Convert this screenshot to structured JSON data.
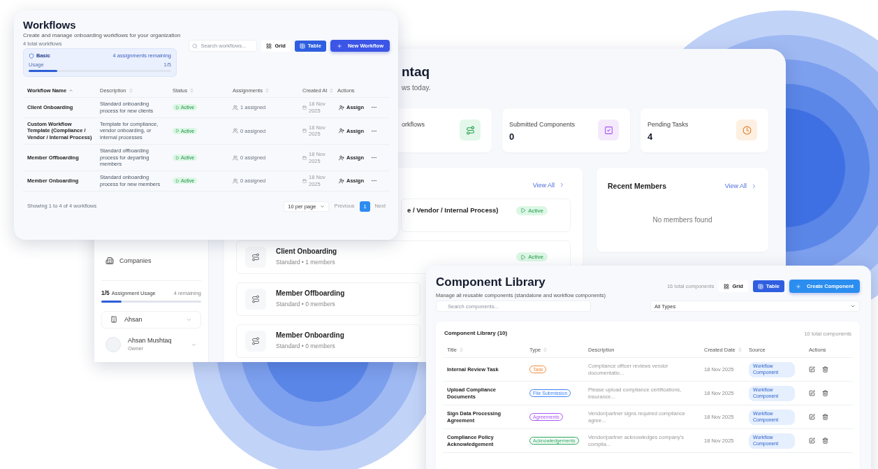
{
  "workflows_window": {
    "title": "Workflows",
    "subtitle": "Create and manage onboarding workflows for your organization",
    "count": "4 total workflows",
    "plan": {
      "name": "Basic",
      "remaining": "4 assignments remaining",
      "usage_label": "Usage",
      "usage": "1/5",
      "level": 0.2
    },
    "search": {
      "placeholder": "Search workflows..."
    },
    "view_toggle": [
      {
        "label": "Grid",
        "selected": false
      },
      {
        "label": "Table",
        "selected": true
      }
    ],
    "new_button": "New Workflow",
    "table": {
      "columns": [
        {
          "label": "Workflow Name",
          "sortable": true,
          "sorted": true
        },
        {
          "label": "Description",
          "sortable": true,
          "sorted": false
        },
        {
          "label": "Status",
          "sortable": true,
          "sorted": false
        },
        {
          "label": "Assignments",
          "sortable": true,
          "sorted": false
        },
        {
          "label": "Created At",
          "sortable": true,
          "sorted": false
        },
        {
          "label": "Actions",
          "sortable": false,
          "sorted": false
        }
      ],
      "rows": [
        {
          "name": "Client Onboarding",
          "description": "Standard onboarding process for new clients",
          "status": "Active",
          "assignments": "1 assigned",
          "created": "18 Nov 2025",
          "action": "Assign"
        },
        {
          "name": "Custom Workflow Template (Compliance / Vendor / Internal Process)",
          "description": "Template for compliance, vendor onboarding, or internal processes",
          "status": "Active",
          "assignments": "0 assigned",
          "created": "18 Nov 2025",
          "action": "Assign"
        },
        {
          "name": "Member Offboarding",
          "description": "Standard offboarding process for departing members",
          "status": "Active",
          "assignments": "0 assigned",
          "created": "18 Nov 2025",
          "action": "Assign"
        },
        {
          "name": "Member Onboarding",
          "description": "Standard onboarding process for new members",
          "status": "Active",
          "assignments": "0 assigned",
          "created": "18 Nov 2025",
          "action": "Assign"
        }
      ]
    },
    "footer": {
      "showing": "Showing 1 to 4 of 4 workflows",
      "per_page": "10 per page",
      "previous": "Previous",
      "pages": [
        {
          "label": "1",
          "selected": true
        }
      ],
      "next": "Next"
    }
  },
  "dashboard": {
    "heading": "ntaq",
    "subheading": "ws today.",
    "stats": [
      {
        "label": "orkflows",
        "kind": "workflow"
      },
      {
        "label": "Submitted Components",
        "value": "0",
        "kind": "components"
      },
      {
        "label": "Pending Tasks",
        "value": "4",
        "kind": "tasks"
      }
    ],
    "recent_workflows": {
      "view_all": "View All",
      "items": [
        {
          "kind": "clipped",
          "name": "e / Vendor / Internal Process)",
          "status": "Active"
        },
        {
          "kind": "full",
          "name": "Client Onboarding",
          "meta": "Standard • 1 members",
          "status": "Active"
        },
        {
          "kind": "cut",
          "name": "Member Offboarding",
          "meta": "Standard • 0 members"
        },
        {
          "kind": "cut",
          "name": "Member Onboarding",
          "meta": "Standard • 0 members"
        }
      ]
    },
    "recent_members": {
      "title": "Recent Members",
      "view_all": "View All",
      "empty": "No members found"
    },
    "sidebar": {
      "nav": [
        {
          "label": "Companies",
          "selected": false
        }
      ],
      "usage": {
        "count": "1/5",
        "label": "Assignment Usage",
        "remaining": "4 remaining",
        "level": 0.2
      },
      "workspace": "Ahsan",
      "user": {
        "name": "Ahsan Mushtaq",
        "role": "Owner"
      }
    }
  },
  "component_library": {
    "title": "Component Library",
    "subtitle": "Manage all reusable components (standalone and workflow components)",
    "total": "16 total components",
    "view_toggle": [
      {
        "label": "Grid",
        "selected": false
      },
      {
        "label": "Table",
        "selected": true
      }
    ],
    "create_button": "Create Component",
    "search": {
      "placeholder": "Search components..."
    },
    "type_filter": "All Types",
    "card": {
      "title": "Component Library (10)",
      "count": "10 total components",
      "columns": [
        {
          "label": "Title",
          "sortable": true
        },
        {
          "label": "Type",
          "sortable": true
        },
        {
          "label": "Description",
          "sortable": false
        },
        {
          "label": "Created Date",
          "sortable": true
        },
        {
          "label": "Source",
          "sortable": false
        },
        {
          "label": "Actions",
          "sortable": false
        }
      ],
      "rows": [
        {
          "title": "Internal Review Task",
          "type": "Task",
          "color": "#f08a3c",
          "description": "Compliance officer reviews vendor documentatio...",
          "created": "18 Nov 2025",
          "source": "Workflow Component"
        },
        {
          "title": "Upload Compliance Documents",
          "type": "File Submission",
          "color": "#3b82f6",
          "description": "Please upload compliance certifications, insurance...",
          "created": "18 Nov 2025",
          "source": "Workflow Component"
        },
        {
          "title": "Sign Data Processing Agreement",
          "type": "Agreements",
          "color": "#a855f7",
          "description": "Vendor/partner signs required compliance agree...",
          "created": "18 Nov 2025",
          "source": "Workflow Component"
        },
        {
          "title": "Compliance Policy Acknowledgement",
          "type": "Acknowledgements",
          "color": "#22a55a",
          "description": "Vendor/partner acknowledges company's complia...",
          "created": "18 Nov 2025",
          "source": "Workflow Component"
        }
      ]
    }
  }
}
